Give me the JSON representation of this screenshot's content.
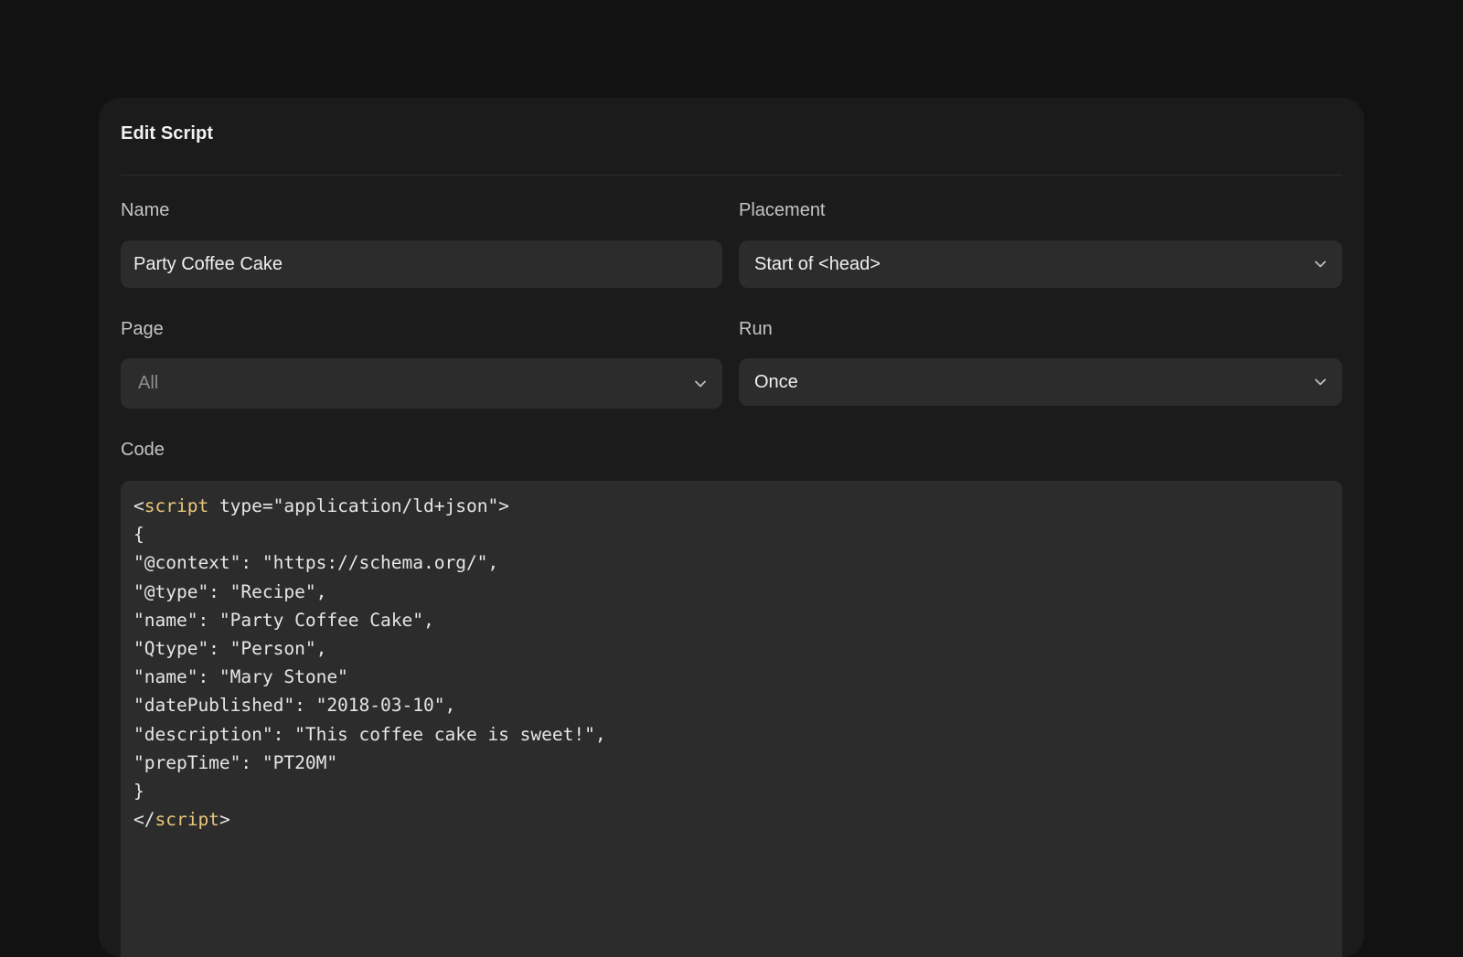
{
  "dialog": {
    "title": "Edit Script"
  },
  "fields": {
    "name": {
      "label": "Name",
      "value": "Party Coffee Cake"
    },
    "placement": {
      "label": "Placement",
      "value": "Start of <head>"
    },
    "page": {
      "label": "Page",
      "value": "All"
    },
    "run": {
      "label": "Run",
      "value": "Once"
    },
    "code": {
      "label": "Code",
      "lines": [
        {
          "prefix": "<",
          "tag": "script",
          "suffix": " type=\"application/ld+json\">"
        },
        {
          "text": "{"
        },
        {
          "text": "\"@context\": \"https://schema.org/\","
        },
        {
          "text": "\"@type\": \"Recipe\","
        },
        {
          "text": "\"name\": \"Party Coffee Cake\","
        },
        {
          "text": "\"Qtype\": \"Person\","
        },
        {
          "text": "\"name\": \"Mary Stone\""
        },
        {
          "text": "\"datePublished\": \"2018-03-10\","
        },
        {
          "text": "\"description\": \"This coffee cake is sweet!\","
        },
        {
          "text": "\"prepTime\": \"PT20M\""
        },
        {
          "text": "}"
        },
        {
          "prefix": "</",
          "tag": "script",
          "suffix": ">"
        }
      ]
    }
  },
  "icons": {
    "dropdown": "chevron-down-icon"
  },
  "colors": {
    "background": "#121212",
    "panel": "#1b1b1b",
    "control": "#2c2c2c",
    "tag_accent": "#e8c77a"
  }
}
